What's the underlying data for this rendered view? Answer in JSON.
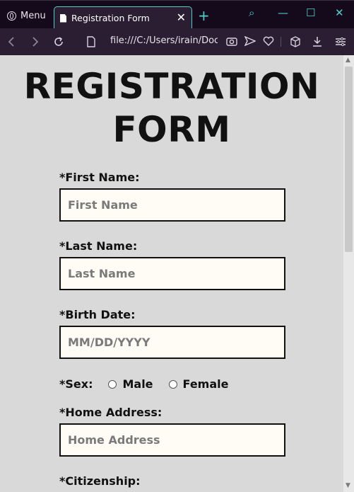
{
  "browser": {
    "menu_label": "Menu",
    "tab_title": "Registration Form",
    "tab_close": "✕",
    "new_tab": "+",
    "url": "file:///C:/Users/irain/Documents",
    "window_controls": {
      "search": "⌕",
      "minimize": "—",
      "maximize": "☐",
      "close": "✕"
    },
    "accent_color": "#4fd1c5"
  },
  "form": {
    "title": "REGISTRATION FORM",
    "first_name": {
      "label": "*First Name:",
      "placeholder": "First Name"
    },
    "last_name": {
      "label": "*Last Name:",
      "placeholder": "Last Name"
    },
    "birth_date": {
      "label": "*Birth Date:",
      "placeholder": "MM/DD/YYYY"
    },
    "sex": {
      "label": "*Sex:",
      "options": [
        "Male",
        "Female"
      ]
    },
    "home_address": {
      "label": "*Home Address:",
      "placeholder": "Home Address"
    },
    "citizenship": {
      "label": "*Citizenship:"
    }
  }
}
